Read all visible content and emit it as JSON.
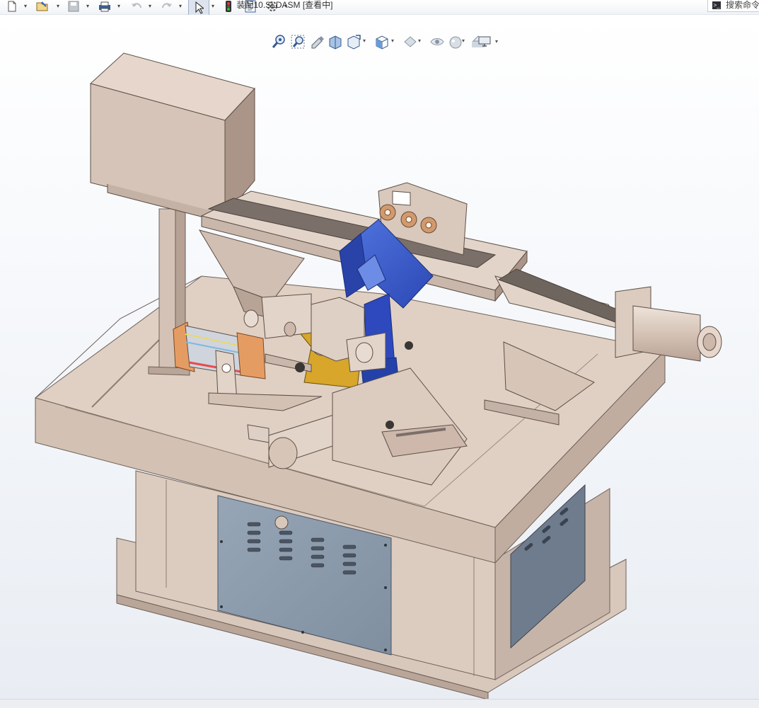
{
  "window": {
    "document_title": "装配10.SLDASM [查看中]",
    "search_placeholder": "搜索命令"
  },
  "toolbar": {
    "buttons": [
      {
        "name": "new-document-icon",
        "has_dropdown": true
      },
      {
        "name": "open-document-icon",
        "has_dropdown": true
      },
      {
        "name": "save-icon",
        "has_dropdown": true
      },
      {
        "name": "print-icon",
        "has_dropdown": true
      },
      {
        "name": "undo-icon",
        "has_dropdown": true
      },
      {
        "name": "redo-icon",
        "has_dropdown": true
      },
      {
        "name": "select-pointer-icon",
        "has_dropdown": true,
        "active": true
      },
      {
        "name": "rebuild-traffic-light-icon",
        "has_dropdown": false
      },
      {
        "name": "file-properties-icon",
        "has_dropdown": false
      },
      {
        "name": "options-gear-icon",
        "has_dropdown": true
      }
    ]
  },
  "heads_up_toolbar": {
    "items": [
      "zoom-to-fit-icon",
      "zoom-to-area-icon",
      "previous-view-icon",
      "section-view-icon",
      "dynamic-annotation-view-icon",
      "view-orientation-icon",
      "display-style-icon",
      "hide-show-items-icon",
      "edit-appearance-icon",
      "apply-scene-icon",
      "view-settings-icon"
    ]
  },
  "colors": {
    "machine_body": "#d7c5b8",
    "machine_shadow": "#a89489",
    "steel_panel": "#8c9bab",
    "motor_blue": "#3a5cc9",
    "mount_blue": "#2d45b8",
    "bracket_gold": "#d6a629",
    "cylinder_orange": "#e59a62",
    "viewport_top": "#ffffff",
    "viewport_bottom": "#e9edf3"
  }
}
